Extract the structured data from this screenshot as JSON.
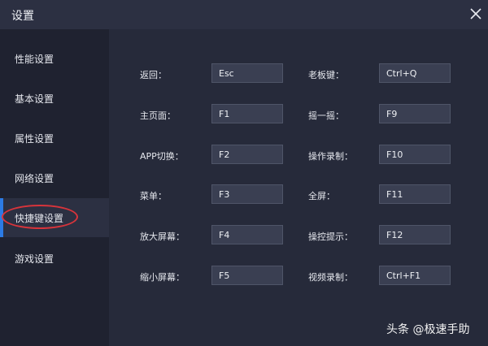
{
  "window": {
    "title": "设置"
  },
  "sidebar": {
    "items": [
      {
        "label": "性能设置"
      },
      {
        "label": "基本设置"
      },
      {
        "label": "属性设置"
      },
      {
        "label": "网络设置"
      },
      {
        "label": "快捷键设置",
        "active": true
      },
      {
        "label": "游戏设置"
      }
    ]
  },
  "shortcuts": {
    "left": [
      {
        "label": "返回：",
        "key": "Esc"
      },
      {
        "label": "主页面：",
        "key": "F1"
      },
      {
        "label": "APP切换：",
        "key": "F2"
      },
      {
        "label": "菜单：",
        "key": "F3"
      },
      {
        "label": "放大屏幕：",
        "key": "F4"
      },
      {
        "label": "缩小屏幕：",
        "key": "F5"
      }
    ],
    "right": [
      {
        "label": "老板键：",
        "key": "Ctrl+Q"
      },
      {
        "label": "摇一摇：",
        "key": "F9"
      },
      {
        "label": "操作录制：",
        "key": "F10"
      },
      {
        "label": "全屏：",
        "key": "F11"
      },
      {
        "label": "操控提示：",
        "key": "F12"
      },
      {
        "label": "视频录制：",
        "key": "Ctrl+F1"
      }
    ]
  },
  "watermark": "头条 @极速手助",
  "colors": {
    "accent": "#2c7be5",
    "annotation_ring": "#d8343b"
  }
}
